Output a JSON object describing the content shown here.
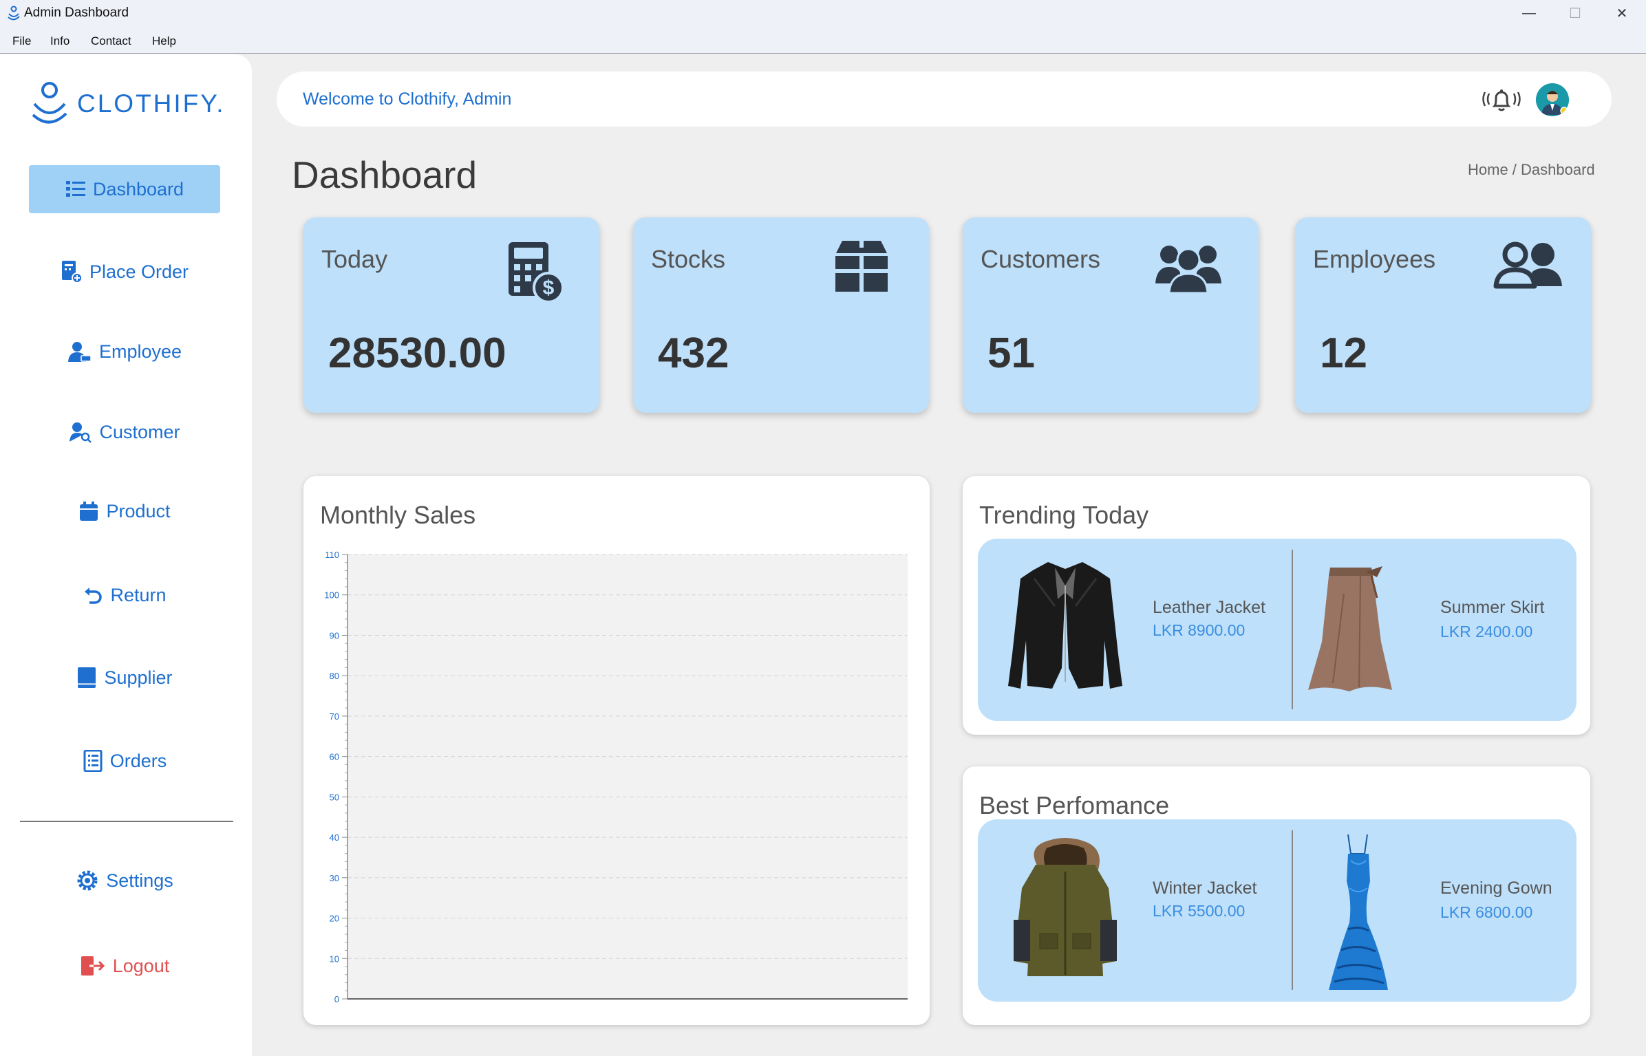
{
  "window": {
    "title": "Admin Dashboard",
    "minimize": "—",
    "maximize": "☐",
    "close": "✕"
  },
  "menu": [
    "File",
    "Info",
    "Contact",
    "Help"
  ],
  "sidebar": {
    "logo": "CLOTHIFY.",
    "items": [
      {
        "label": "Dashboard",
        "icon": "list-icon"
      },
      {
        "label": "Place Order",
        "icon": "order-icon"
      },
      {
        "label": "Employee",
        "icon": "employee-icon"
      },
      {
        "label": "Customer",
        "icon": "customer-search-icon"
      },
      {
        "label": "Product",
        "icon": "product-icon"
      },
      {
        "label": "Return",
        "icon": "return-icon"
      },
      {
        "label": "Supplier",
        "icon": "supplier-icon"
      },
      {
        "label": "Orders",
        "icon": "orders-icon"
      }
    ],
    "settings": "Settings",
    "logout": "Logout"
  },
  "topbar": {
    "welcome": "Welcome to Clothify, Admin"
  },
  "page": {
    "title": "Dashboard",
    "breadcrumb": "Home / Dashboard"
  },
  "stats": [
    {
      "label": "Today",
      "value": "28530.00",
      "icon": "calculator-dollar-icon"
    },
    {
      "label": "Stocks",
      "value": "432",
      "icon": "box-icon"
    },
    {
      "label": "Customers",
      "value": "51",
      "icon": "group-icon"
    },
    {
      "label": "Employees",
      "value": "12",
      "icon": "users-icon"
    }
  ],
  "monthly_sales": {
    "title": "Monthly Sales"
  },
  "chart_data": {
    "type": "bar",
    "title": "Monthly Sales",
    "categories": [],
    "values": [],
    "ylim": [
      0,
      110
    ],
    "yticks": [
      0,
      10,
      20,
      30,
      40,
      50,
      60,
      70,
      80,
      90,
      100,
      110
    ],
    "grid": true
  },
  "trending": {
    "title": "Trending Today",
    "items": [
      {
        "name": "Leather Jacket",
        "price": "LKR 8900.00"
      },
      {
        "name": "Summer Skirt",
        "price": "LKR 2400.00"
      }
    ]
  },
  "best": {
    "title": "Best Perfomance",
    "items": [
      {
        "name": "Winter Jacket",
        "price": "LKR 5500.00"
      },
      {
        "name": "Evening Gown",
        "price": "LKR 6800.00"
      }
    ]
  },
  "colors": {
    "accent": "#1e6fd0",
    "card": "#bee0fa",
    "active": "#9fd1f7",
    "logout": "#e05050"
  }
}
